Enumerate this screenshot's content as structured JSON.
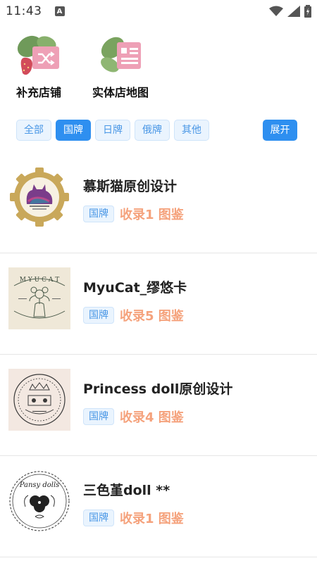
{
  "status_bar": {
    "time": "11:43",
    "notification_letter": "A"
  },
  "shortcuts": [
    {
      "label": "补充店铺",
      "icon": "shuffle-icon"
    },
    {
      "label": "实体店地图",
      "icon": "map-icon"
    }
  ],
  "filters": {
    "chips": [
      "全部",
      "国牌",
      "日牌",
      "俄牌",
      "其他"
    ],
    "active_index": 1,
    "expand_label": "展开"
  },
  "shops": [
    {
      "name": "慕斯猫原创设计",
      "tag": "国牌",
      "count_text": "收录1 图鉴",
      "logo": "gear-cat-logo"
    },
    {
      "name": "MyuCat_缪悠卡",
      "tag": "国牌",
      "count_text": "收录5 图鉴",
      "logo": "myu-cat-logo"
    },
    {
      "name": "Princess doll原创设计",
      "tag": "国牌",
      "count_text": "收录4 图鉴",
      "logo": "princess-doll-logo"
    },
    {
      "name": "三色堇doll **",
      "tag": "国牌",
      "count_text": "收录1 图鉴",
      "logo": "pansy-doll-logo"
    }
  ],
  "colors": {
    "accent": "#2e8ff0",
    "chip_bg": "#eaf4fe",
    "chip_text": "#4a97e6",
    "count_text": "#f5a27c"
  }
}
